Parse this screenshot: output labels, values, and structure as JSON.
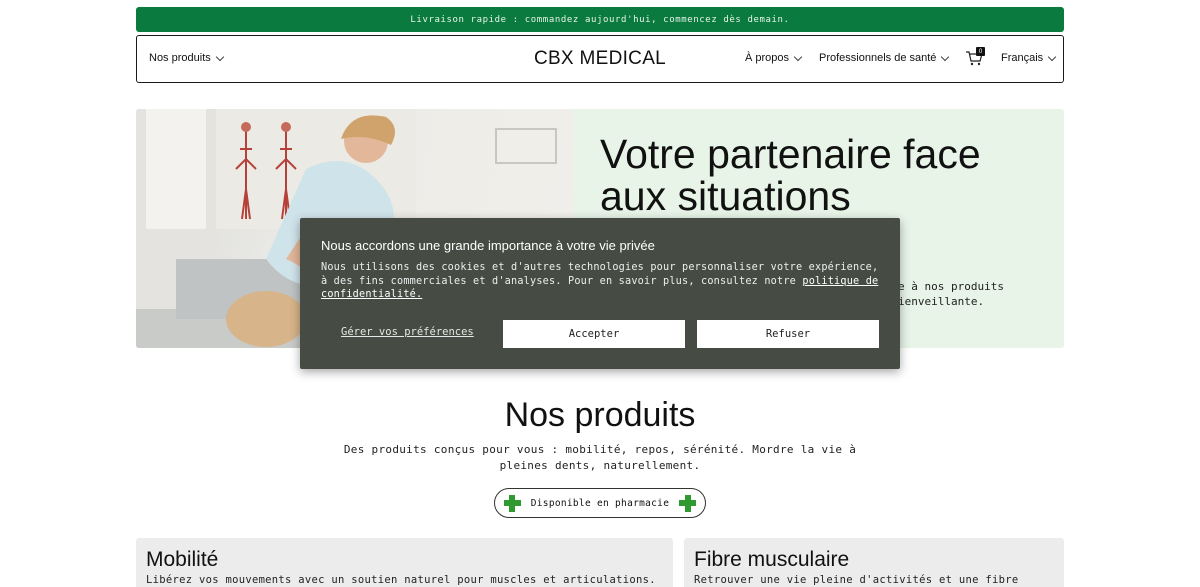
{
  "announcement": "Livraison rapide : commandez aujourd'hui, commencez dès demain.",
  "nav": {
    "products": "Nos produits",
    "brand": "CBX MEDICAL",
    "about": "À propos",
    "health_pros": "Professionnels de santé",
    "cart_count": "0",
    "language": "Français"
  },
  "hero": {
    "title": "Votre partenaire face aux situations",
    "subtitle": "e à nos produits ienveillante."
  },
  "cookie": {
    "title": "Nous accordons une grande importance à votre vie privée",
    "body": "Nous utilisons des cookies et d'autres technologies pour personnaliser votre expérience, à des fins commerciales et d'analyses. Pour en savoir plus, consultez notre",
    "policy_link": "politique de confidentialité.",
    "manage": "Gérer vos préférences",
    "accept": "Accepter",
    "refuse": "Refuser"
  },
  "products": {
    "title": "Nos produits",
    "subtitle": "Des produits conçus pour vous : mobilité, repos, sérénité. Mordre la vie à pleines dents, naturellement.",
    "pharmacy_badge": "Disponible en pharmacie"
  },
  "cards": [
    {
      "title": "Mobilité",
      "desc": "Libérez vos mouvements avec un soutien naturel pour muscles et articulations."
    },
    {
      "title": "Fibre musculaire",
      "desc": "Retrouver une vie pleine d'activités et une fibre"
    }
  ],
  "colors": {
    "announce_bg": "#0a7a3e",
    "hero_bg": "#e7f4e7",
    "cookie_bg": "#464c44",
    "pharmacy_cross": "#2f9a2f"
  },
  "icons": [
    "chevron-down-icon",
    "cart-icon",
    "pharmacy-cross-icon"
  ]
}
